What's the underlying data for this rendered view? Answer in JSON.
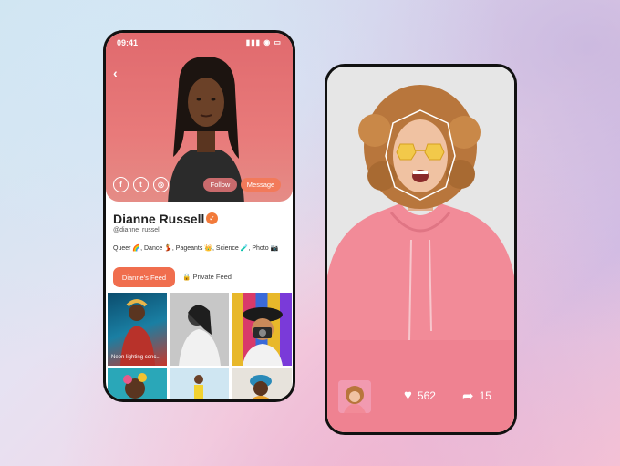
{
  "profile_screen": {
    "status_time": "09:41",
    "name": "Dianne Russell",
    "handle": "@dianne_russell",
    "interests": "Queer 🌈, Dance 💃, Pageants 👑, Science 🧪, Photo 📷",
    "follow_label": "Follow",
    "message_label": "Message",
    "feed_tab_label": "Dianne's Feed",
    "private_feed_label": "Private Feed",
    "tile_caption": "Neon lighting conc..."
  },
  "video_screen": {
    "likes": "562",
    "shares": "15"
  },
  "colors": {
    "accent": "#f06e4e",
    "hero": "#e06a6e"
  }
}
